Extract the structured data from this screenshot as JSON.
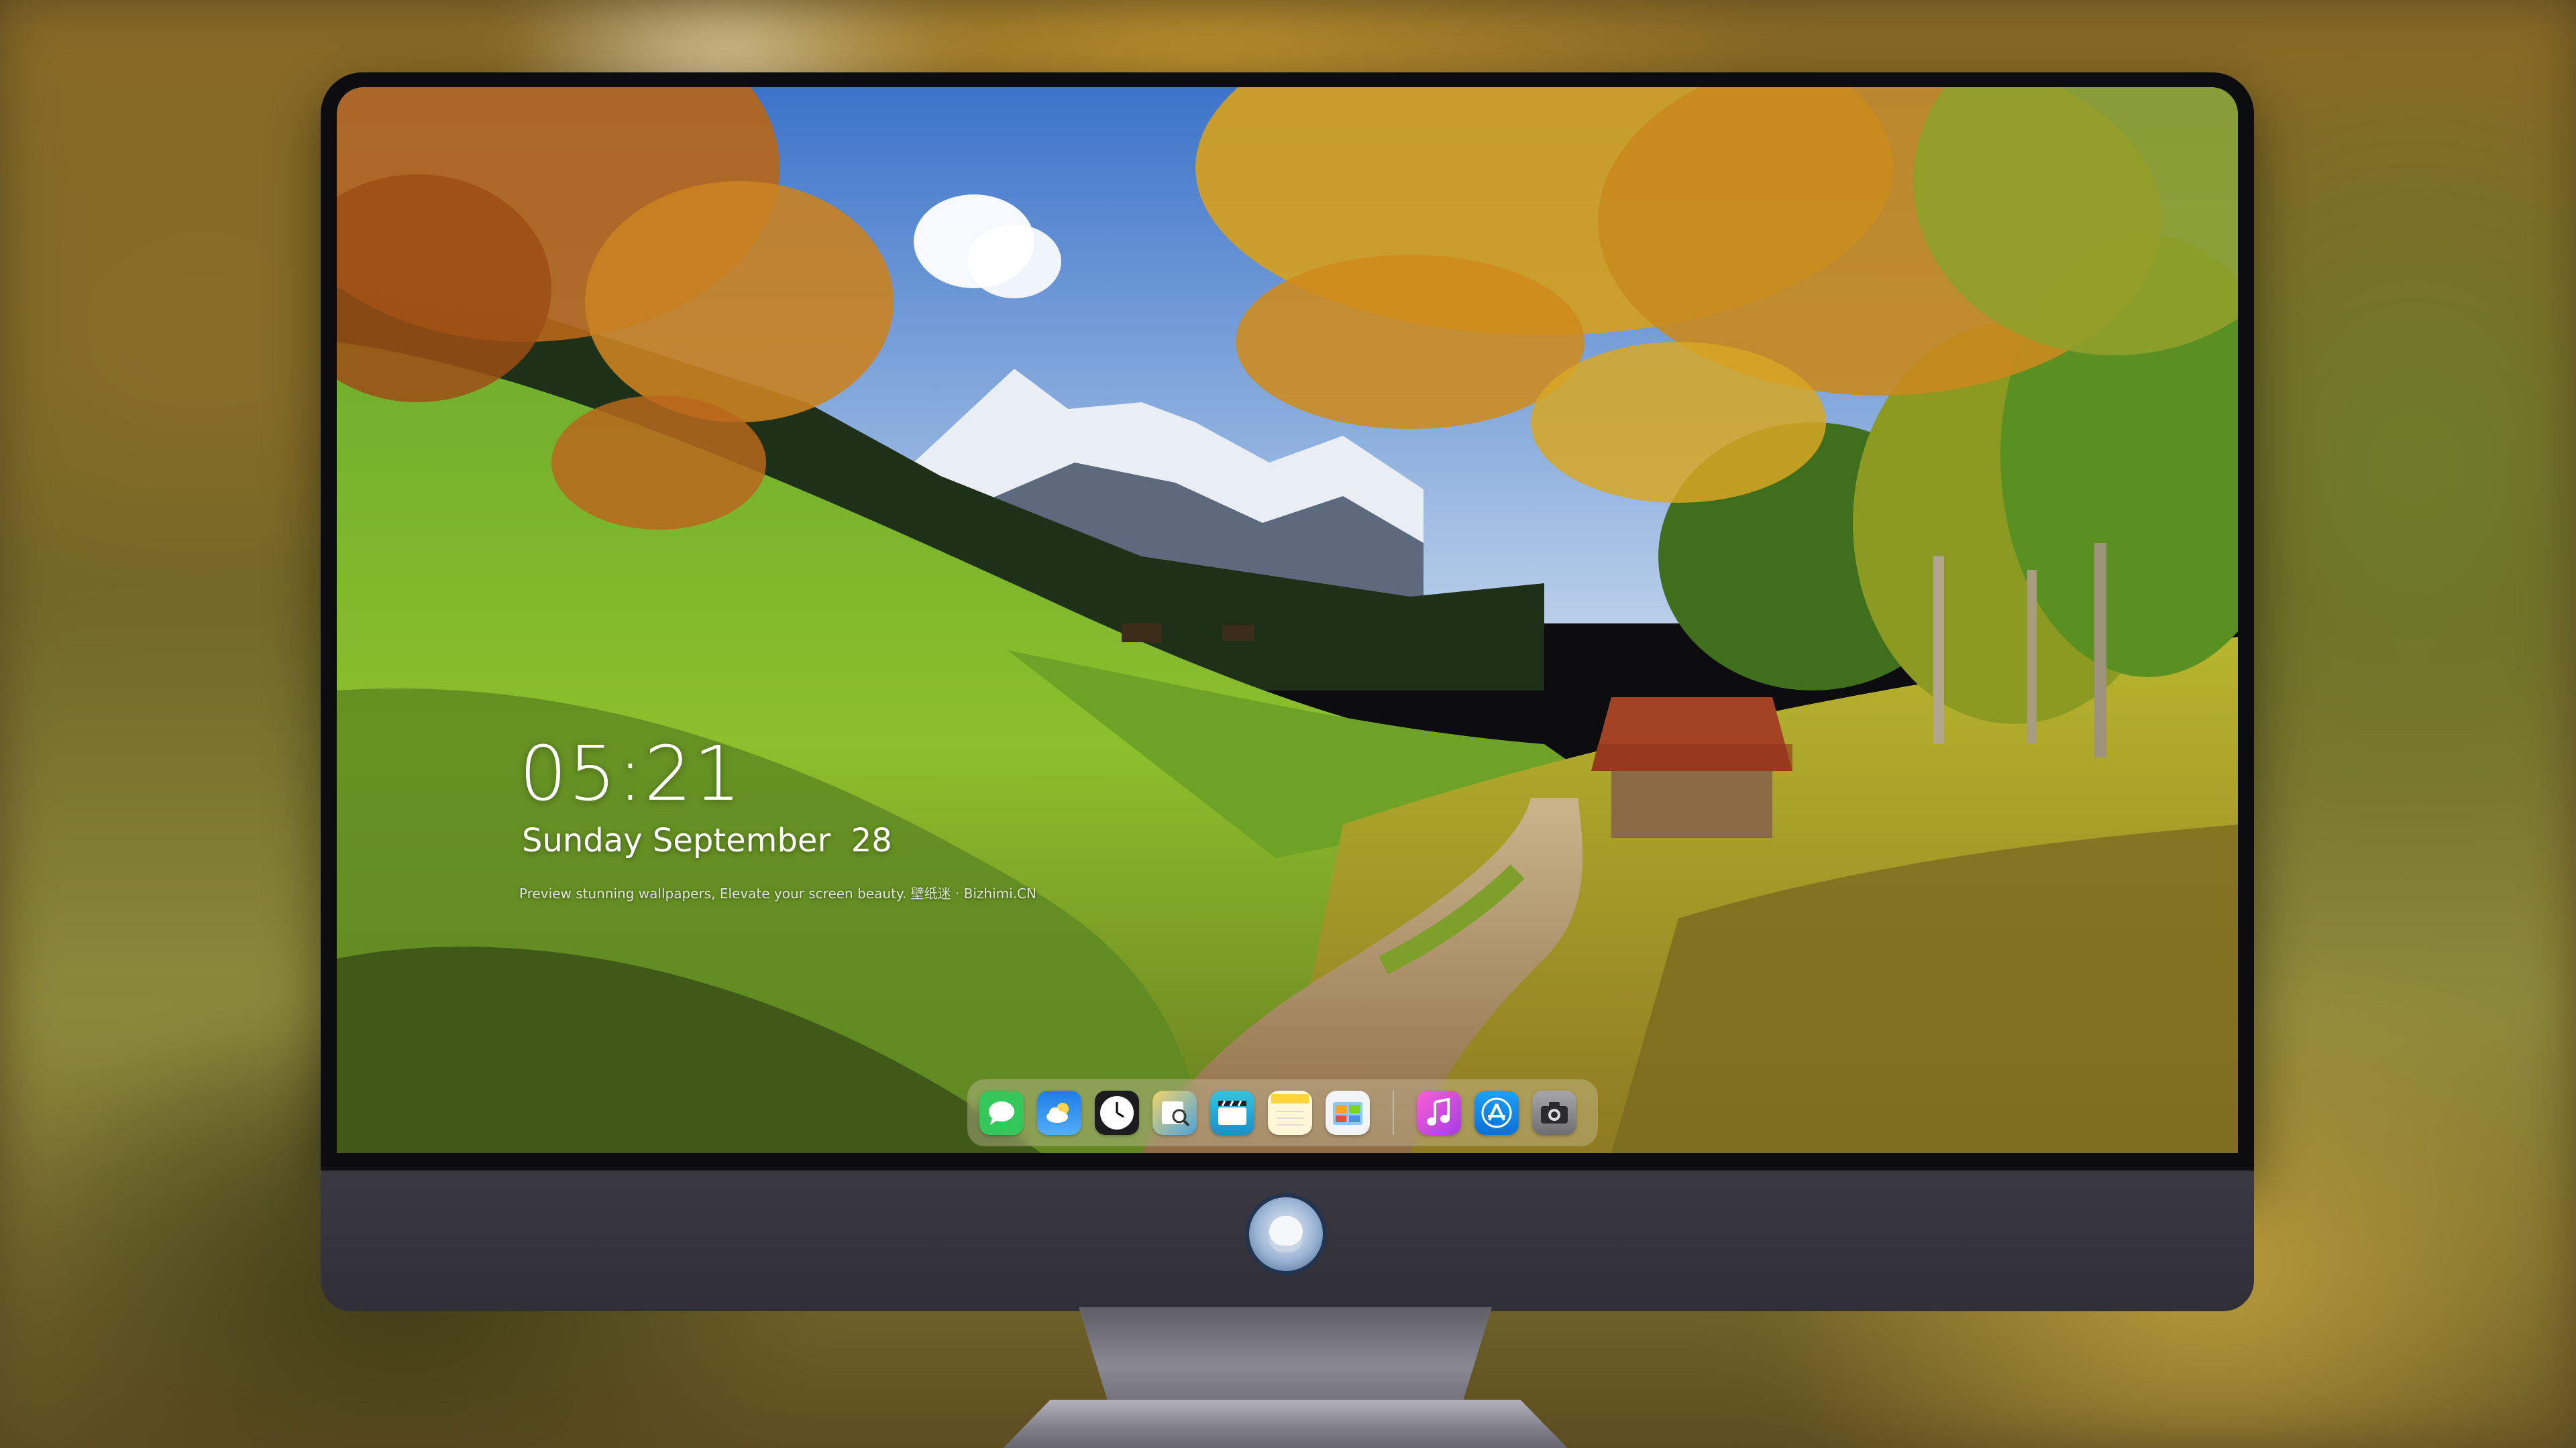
{
  "lock_screen": {
    "time": "05:21",
    "date": "Sunday September  28",
    "caption": "Preview stunning wallpapers, Elevate your screen beauty. 壁纸迷 · Bizhimi.CN"
  },
  "dock": {
    "apps": [
      {
        "name": "messages-icon",
        "color": "#34c759"
      },
      {
        "name": "weather-icon",
        "color": "#2f8ff0"
      },
      {
        "name": "clock-icon",
        "color": "#ffffff"
      },
      {
        "name": "preview-icon",
        "color": "#e8c65a"
      },
      {
        "name": "video-editor-icon",
        "color": "#29b6d8"
      },
      {
        "name": "notes-icon",
        "color": "#ffd84a"
      },
      {
        "name": "photo-gallery-icon",
        "color": "#e9ecef"
      },
      {
        "name": "music-icon",
        "color": "#e64ad6"
      },
      {
        "name": "app-store-icon",
        "color": "#1f8ff2"
      },
      {
        "name": "camera-icon",
        "color": "#8e8e93"
      }
    ]
  }
}
